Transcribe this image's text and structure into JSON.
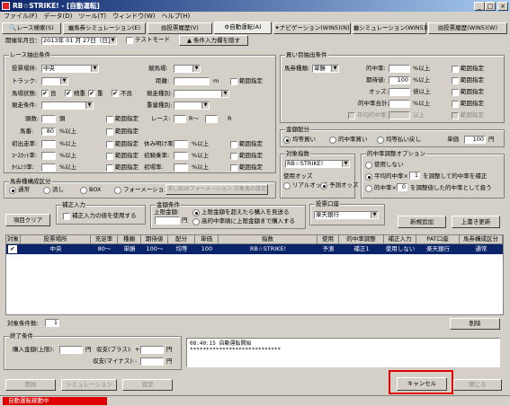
{
  "window": {
    "title": "RB☆STRIKE! - [自動運転]",
    "min": "_",
    "max": "□",
    "close": "×"
  },
  "menu": [
    "ファイル(F)",
    "データ(D)",
    "ツール(T)",
    "ウィンドウ(W)",
    "ヘルプ(H)"
  ],
  "tabs": [
    "レース検索(S)",
    "馬券シミュレーション(E)",
    "投票履歴(V)",
    "自動運転(A)",
    "ナビゲーション(WIN5)(N)",
    "シミュレーション(WIN5)(M)",
    "投票履歴(WIN5)(W)"
  ],
  "top": {
    "date_label": "開催年月日：",
    "date_value": "2013年 01 月 27日（日）",
    "test_mode": "テストモード",
    "condition_button": "▲ 条件入力欄を隠す"
  },
  "race": {
    "title": "レース抽出条件",
    "place_label": "投票場所:",
    "place_value": "中央",
    "track_label": "トラック:",
    "baba_label": "馬場状態:",
    "baba_options": [
      "良",
      "稍重",
      "重",
      "不良"
    ],
    "kyoso_label": "競走条件:",
    "tosu_label": "頭数:",
    "tosu_unit": "頭",
    "fav_label": "馬番:",
    "fav_value": "80",
    "fav_unit": "%以上",
    "init_label": "初出走率:",
    "init_unit": "%以上",
    "init2_label": "ｺｰｽｶｯﾄ率:",
    "init2_unit": "%以上",
    "init3_label": "ﾀｲﾑﾐﾂ率:",
    "init3_unit": "%以上",
    "keibajo_label": "競馬場:",
    "kyori_label": "距離:",
    "kyori_unit": "m",
    "shubetsu_label": "競走種別:",
    "juryo_label": "重量種別:",
    "race_label": "レース:",
    "race_unit1": "R〜",
    "race_unit2": "R",
    "kyuyo_label": "休み明け率:",
    "kyuyo_unit": "%以上",
    "shoki_label": "初騎乗率:",
    "shoki_unit": "%以上",
    "shoba_label": "初場率:",
    "shoba_unit": "%以上",
    "range": "範囲指定"
  },
  "bet_type": {
    "title": "馬券種構成区分",
    "options": [
      "通常",
      "流し",
      "BOX",
      "フォーメーション"
    ],
    "nagashi_button": "流しBOXフォーメーション 対象馬の設定"
  },
  "correct": {
    "title": "補正入力",
    "label": "補正入力の値を使用する"
  },
  "amount": {
    "title": "金額条件",
    "limit_label": "上限金額:",
    "unit": "円",
    "opt1": "上限金額を超えたら購入を見送る",
    "opt2": "高的中率順に上限金額まで購入する"
  },
  "clear_button": "項目クリア",
  "buy": {
    "title": "買い目抽出条件",
    "type_label": "馬券種類:",
    "type_value": "単勝",
    "hit_label": "的中率:",
    "hit_unit": "%以上",
    "expect_label": "期待値:",
    "expect_value": "100",
    "expect_unit": "%以上",
    "odds_label": "オッズ:",
    "odds_unit": "倍以上",
    "hit_total_label": "的中率合計:",
    "hit_total_unit": "%以上",
    "avg_label": "平均的中率",
    "avg_unit": "以上",
    "range": "範囲指定"
  },
  "money": {
    "title": "金額配分",
    "opts": [
      "均等買い",
      "的中率買い",
      "均等払い戻し"
    ],
    "unit_label": "単価",
    "unit_value": "100",
    "unit_yen": "円"
  },
  "target": {
    "title": "対象指数",
    "value": "RB☆STRIKE!"
  },
  "odds": {
    "title": "使用オッズ",
    "opts": [
      "リアルオッズ",
      "予測オッズ"
    ]
  },
  "hit_adjust": {
    "title": "的中率調整オプション",
    "opts": [
      "使用しない",
      "平均的中率×",
      "的中率×"
    ],
    "v1": "1",
    "v2": "0",
    "t1": "を調整して的中率を補正",
    "t2": "を調整値した的中率として扱う"
  },
  "account": {
    "title": "投票口座",
    "value": "楽天銀行"
  },
  "new_button": "新規追加",
  "overwrite_button": "上書き更新",
  "grid": {
    "headers": [
      "対象",
      "投票場所",
      "充足率",
      "種類",
      "期待値",
      "配分",
      "単価",
      "指数",
      "使用",
      "的中率調整",
      "補正入力",
      "PAT口座",
      "馬券構成区分"
    ],
    "rows": [
      [
        "✔",
        "中央",
        "80〜",
        "単勝",
        "100〜",
        "均等",
        "100",
        "RB☆STRIKE!",
        "予測",
        "補正1",
        "使用しない",
        "楽天銀行",
        "通常"
      ]
    ]
  },
  "count": {
    "label": "対象条件数:",
    "value": "1"
  },
  "delete_button": "削除",
  "end": {
    "title": "終了条件",
    "buy_label": "購入金額(上限):",
    "plus_label": "収支(プラス):",
    "minus_label": "収支(マイナス):",
    "unit": "円",
    "plus_sign": "+",
    "minus_sign": "-"
  },
  "log": [
    "08:40:15  自動運転開始",
    "****************************"
  ],
  "bottom": {
    "start": "開始",
    "sim": "シミュレーション",
    "settings": "設定",
    "cancel": "キャンセル",
    "close": "閉じる"
  },
  "status": "自動運転稼動中"
}
